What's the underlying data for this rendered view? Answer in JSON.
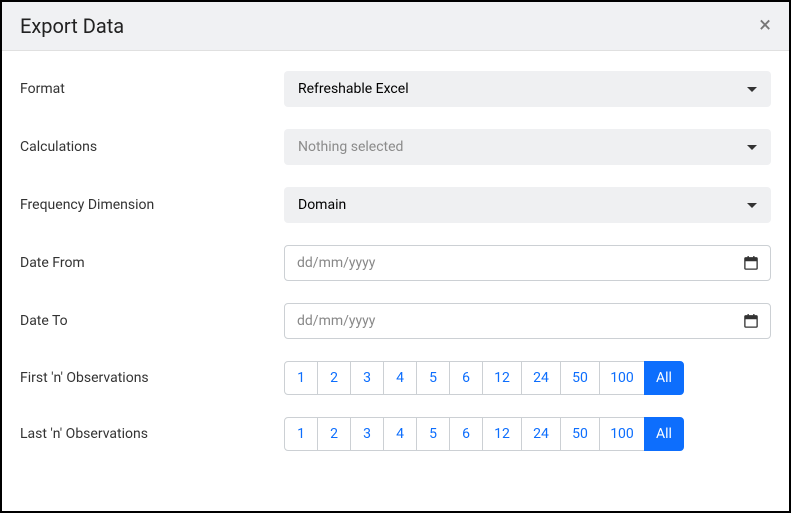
{
  "header": {
    "title": "Export Data",
    "close": "×"
  },
  "labels": {
    "format": "Format",
    "calculations": "Calculations",
    "frequency": "Frequency Dimension",
    "date_from": "Date From",
    "date_to": "Date To",
    "first_n": "First 'n' Observations",
    "last_n": "Last 'n' Observations"
  },
  "format": {
    "value": "Refreshable Excel"
  },
  "calculations": {
    "value": "Nothing selected"
  },
  "frequency": {
    "value": "Domain"
  },
  "date_from": {
    "placeholder": "dd/mm/yyyy"
  },
  "date_to": {
    "placeholder": "dd/mm/yyyy"
  },
  "n_options": {
    "b0": "1",
    "b1": "2",
    "b2": "3",
    "b3": "4",
    "b4": "5",
    "b5": "6",
    "b6": "12",
    "b7": "24",
    "b8": "50",
    "b9": "100",
    "b10": "All"
  }
}
